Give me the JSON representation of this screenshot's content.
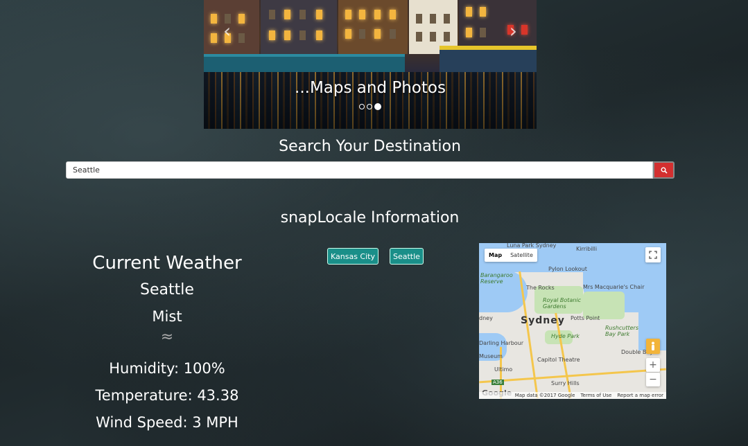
{
  "carousel": {
    "caption": "...Maps and Photos",
    "prev_icon": "chevron-left-icon",
    "next_icon": "chevron-right-icon",
    "slide_count": 3,
    "active_slide": 3
  },
  "search": {
    "title": "Search Your Destination",
    "value": "Seattle",
    "button_icon": "search-icon",
    "button_color": "#d32f2f"
  },
  "info": {
    "title": "snapLocale Information"
  },
  "weather": {
    "heading": "Current Weather",
    "city": "Seattle",
    "description": "Mist",
    "icon": "mist-icon",
    "humidity": "Humidity: 100%",
    "temperature": "Temperature: 43.38",
    "wind": "Wind Speed: 3 MPH"
  },
  "history": {
    "chips": [
      "Kansas City",
      "Seattle"
    ],
    "chip_color": "#1a8f89"
  },
  "map": {
    "type_map": "Map",
    "type_satellite": "Satellite",
    "labels": {
      "sydney": "Sydney",
      "luna_park": "Luna Park Sydney",
      "kirribilli": "Kirribilli",
      "pylon": "Pylon Lookout",
      "barangaroo": "Barangaroo Reserve",
      "rocks": "The Rocks",
      "mrs_macquarie": "Mrs Macquarie's Chair",
      "botanic": "Royal Botanic Gardens",
      "potts_point": "Potts Point",
      "rushcutters": "Rushcutters Bay Park",
      "hyde_park": "Hyde Park",
      "darling_harbour": "Darling Harbour",
      "museum": "Museum",
      "capitol": "Capitol Theatre",
      "ultimo": "Ultimo",
      "surry_hills": "Surry Hills",
      "double_bay": "Double Bay",
      "sydney_w": "dney",
      "a36": "A36"
    },
    "google": "Google",
    "attribution": "Map data ©2017 Google",
    "terms": "Terms of Use",
    "report": "Report a map error"
  }
}
